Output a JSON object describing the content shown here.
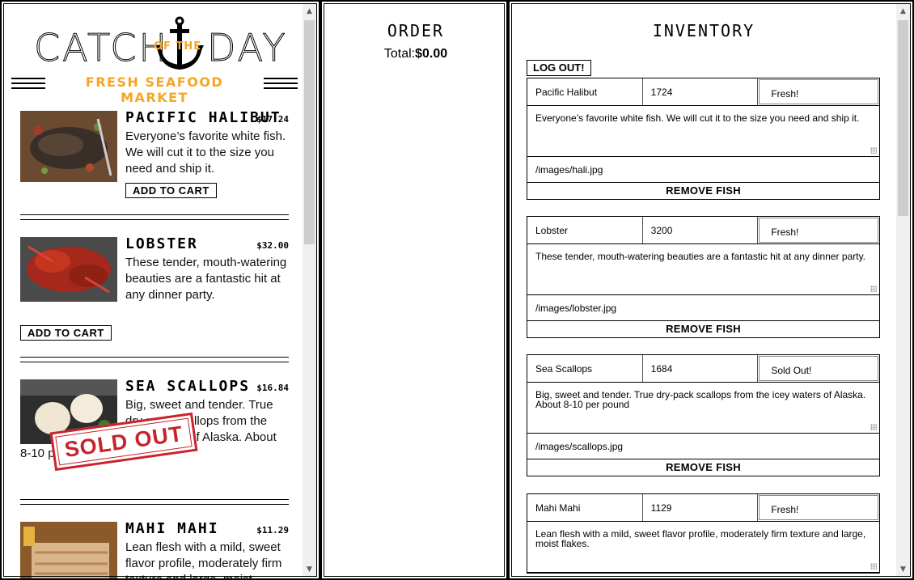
{
  "brand": {
    "left_word": "CATCH",
    "of_the": "OF THE",
    "right_word": "DAY",
    "tagline": "FRESH SEAFOOD MARKET",
    "accent_color": "#f5a623"
  },
  "menu": {
    "items": [
      {
        "name": "PACIFIC HALIBUT",
        "price": "$17.24",
        "desc": "Everyone’s favorite white fish. We will cut it to the size you need and ship it.",
        "button": "ADD TO CART",
        "status": "available"
      },
      {
        "name": "LOBSTER",
        "price": "$32.00",
        "desc": "These tender, mouth-watering beauties are a fantastic hit at any dinner party.",
        "button": "ADD TO CART",
        "status": "available"
      },
      {
        "name": "SEA SCALLOPS",
        "price": "$16.84",
        "desc": "Big, sweet and tender. True dry-pack scallops from the icey waters of Alaska. About 8-10 per pound",
        "stamp": "SOLD OUT",
        "status": "sold-out"
      },
      {
        "name": "MAHI MAHI",
        "price": "$11.29",
        "desc": "Lean flesh with a mild, sweet flavor profile, moderately firm texture and large, moist flakes.",
        "status": "available"
      }
    ]
  },
  "order": {
    "title": "ORDER",
    "total_label": "Total:",
    "total_value": "$0.00"
  },
  "inventory": {
    "title": "INVENTORY",
    "logout_label": "LOG OUT!",
    "remove_label": "REMOVE FISH",
    "fishes": [
      {
        "name": "Pacific Halibut",
        "price": "1724",
        "status": "Fresh!",
        "desc": "Everyone’s favorite white fish. We will cut it to the size you need and ship it.",
        "image": "/images/hali.jpg"
      },
      {
        "name": "Lobster",
        "price": "3200",
        "status": "Fresh!",
        "desc": "These tender, mouth-watering beauties are a fantastic hit at any dinner party.",
        "image": "/images/lobster.jpg"
      },
      {
        "name": "Sea Scallops",
        "price": "1684",
        "status": "Sold Out!",
        "desc": "Big, sweet and tender. True dry-pack scallops from the icey waters of Alaska. About 8-10 per pound",
        "image": "/images/scallops.jpg"
      },
      {
        "name": "Mahi Mahi",
        "price": "1129",
        "status": "Fresh!",
        "desc": "Lean flesh with a mild, sweet flavor profile, moderately firm texture and large, moist flakes.",
        "image": ""
      }
    ]
  },
  "icons": [
    "anchor-icon",
    "scroll-up-icon",
    "scroll-down-icon",
    "resize-grip-icon"
  ],
  "colors": {
    "sold_out": "#c8232c",
    "accent": "#f5a623"
  }
}
